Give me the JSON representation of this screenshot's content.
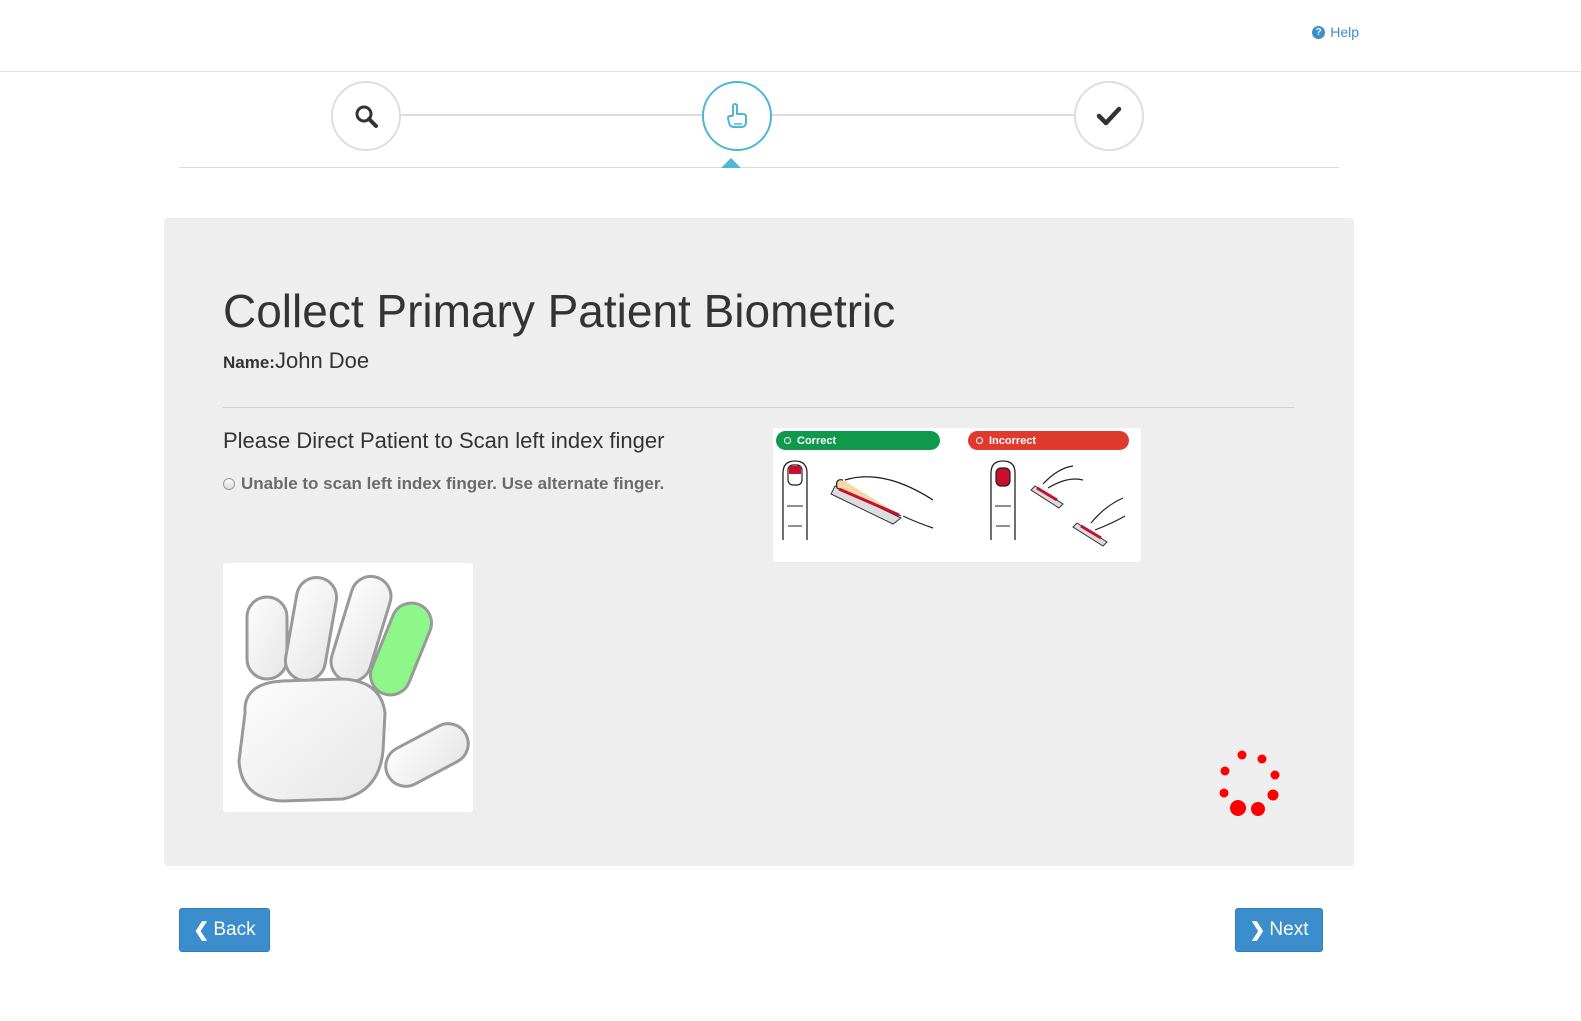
{
  "header": {
    "help_label": "Help",
    "help_icon": "question-circle-icon"
  },
  "stepper": {
    "steps": [
      {
        "icon": "search-icon",
        "state": "complete"
      },
      {
        "icon": "finger-pointing-icon",
        "state": "active"
      },
      {
        "icon": "checkmark-icon",
        "state": "pending"
      }
    ],
    "active_color": "#4cb8d6"
  },
  "main": {
    "title": "Collect Primary Patient Biometric",
    "name_label": "Name:",
    "name_value": "John Doe",
    "instruction": "Please Direct Patient to Scan left index finger",
    "alternate_option": "Unable to scan left index finger. Use alternate finger.",
    "guide": {
      "correct_label": "Correct",
      "incorrect_label": "Incorrect",
      "correct_color": "#0e9a4a",
      "incorrect_color": "#e03a2e"
    },
    "hand_diagram": {
      "highlighted_finger": "left index",
      "highlight_color": "#8df78a"
    },
    "spinner_color": "#ff0000"
  },
  "buttons": {
    "back_label": "Back",
    "next_label": "Next",
    "color": "#3c8dcb"
  }
}
